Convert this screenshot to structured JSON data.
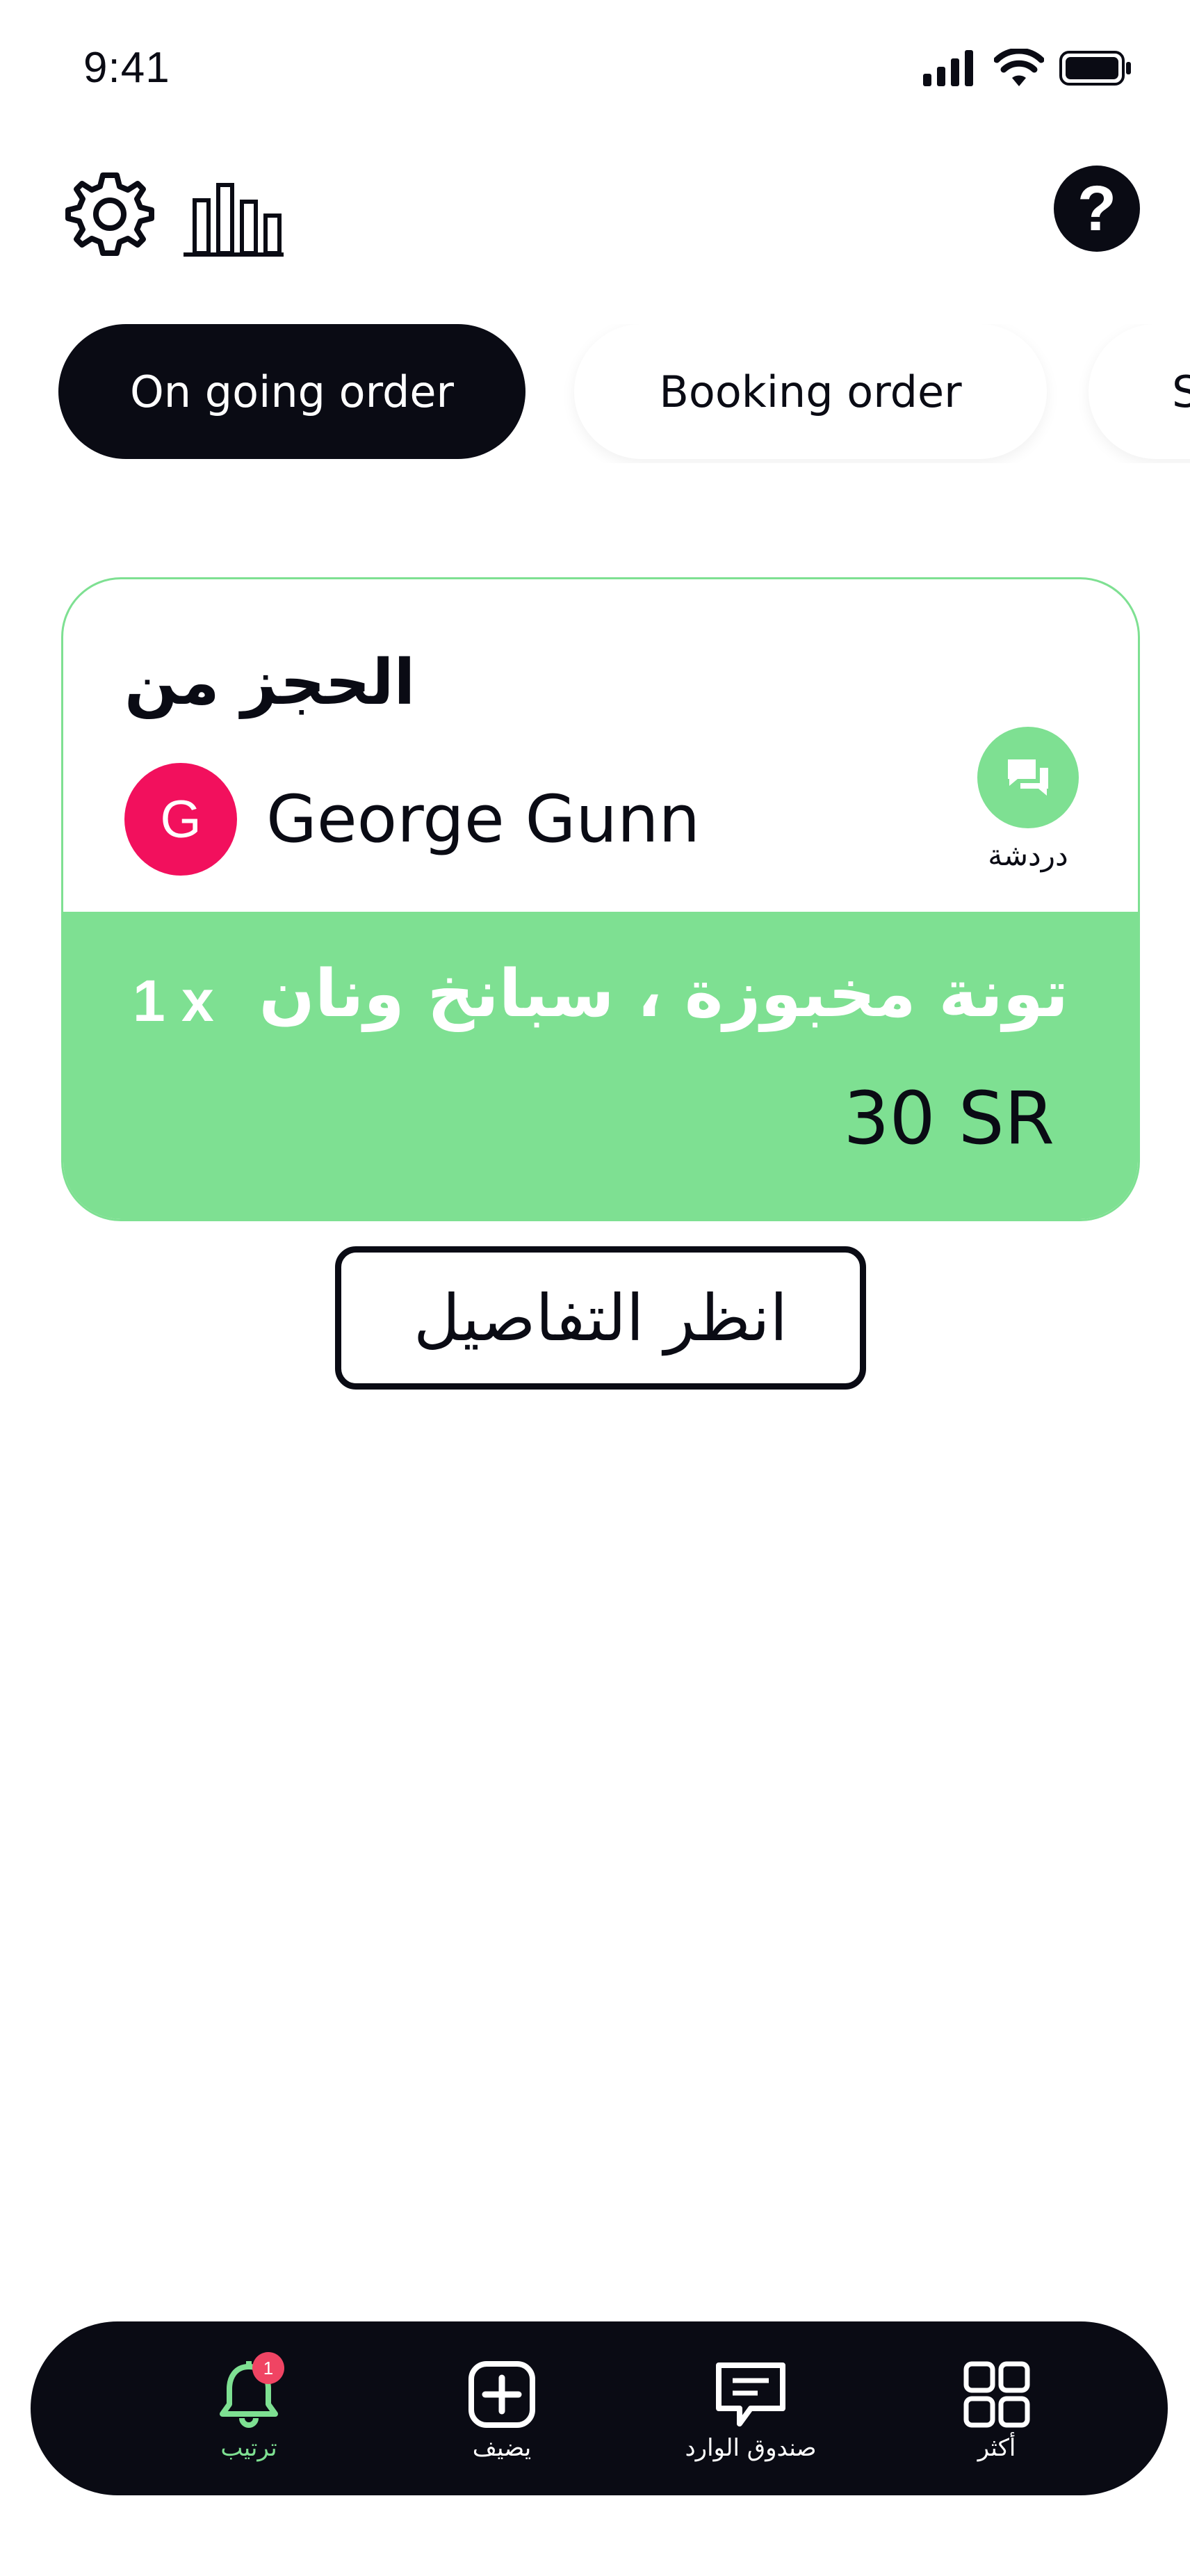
{
  "status_bar": {
    "time": "9:41",
    "icons": [
      "signal-icon",
      "wifi-icon",
      "battery-icon"
    ]
  },
  "toolbar": {
    "icons": [
      "gear-icon",
      "bar-chart-icon"
    ],
    "help_label": "?"
  },
  "tabs": [
    {
      "label": "On going order",
      "active": true
    },
    {
      "label": "Booking order",
      "active": false
    },
    {
      "label": "S",
      "active": false
    }
  ],
  "order_card": {
    "heading": "الحجز من",
    "customer": {
      "initial": "G",
      "name": "George Gunn"
    },
    "chat_label": "دردشة",
    "item": {
      "quantity": "1 x",
      "name": "تونة مخبوزة ، سبانخ ونان",
      "price": "30 SR"
    }
  },
  "details_button": "انظر التفاصيل",
  "bottom_nav": {
    "items": [
      {
        "label": "ترتيب",
        "icon": "bell-icon",
        "active": true,
        "badge": "1"
      },
      {
        "label": "يضيف",
        "icon": "plus-square-icon",
        "active": false
      },
      {
        "label": "صندوق الوارد",
        "icon": "message-icon",
        "active": false
      },
      {
        "label": "أكثر",
        "icon": "grid-icon",
        "active": false
      }
    ]
  },
  "colors": {
    "dark": "#0a0b14",
    "accent_green": "#7ee092",
    "avatar_pink": "#f2105d",
    "badge_red": "#f04463"
  }
}
